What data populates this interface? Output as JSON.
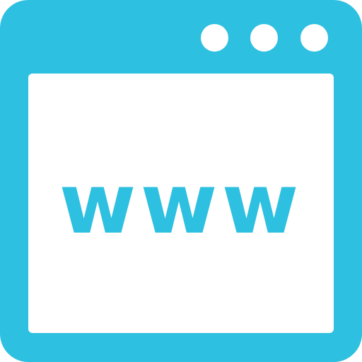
{
  "colors": {
    "frame": "#2EC0E0",
    "content": "#FFFFFF"
  },
  "icon": {
    "name": "browser-window-icon",
    "text": "www",
    "titlebar_dots": 3
  }
}
